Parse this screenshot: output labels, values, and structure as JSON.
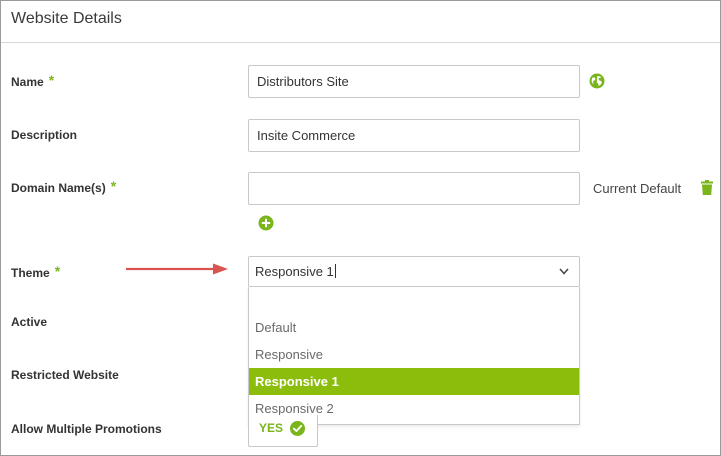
{
  "header": {
    "title": "Website Details"
  },
  "form": {
    "required_marker": "*",
    "name": {
      "label": "Name",
      "value": "Distributors Site"
    },
    "description": {
      "label": "Description",
      "value": "Insite Commerce"
    },
    "domain": {
      "label": "Domain Name(s)",
      "value": "",
      "current_default": "Current Default"
    },
    "theme": {
      "label": "Theme",
      "value": "Responsive 1",
      "options": [
        "Default",
        "Responsive",
        "Responsive 1",
        "Responsive 2"
      ],
      "selected_index": 2
    },
    "active": {
      "label": "Active"
    },
    "restricted": {
      "label": "Restricted Website"
    },
    "allow_multiple_promotions": {
      "label": "Allow Multiple Promotions",
      "value": "YES"
    }
  },
  "colors": {
    "accent_green": "#7ab51d",
    "selected_option_bg": "#8cbd0c",
    "arrow_red": "#d9534f"
  },
  "icons": {
    "name_field": "globe-icon",
    "domain_delete": "trash-icon",
    "domain_add": "plus-circle-icon",
    "theme_toggle": "chevron-down-icon",
    "yes_toggle": "check-circle-icon"
  }
}
